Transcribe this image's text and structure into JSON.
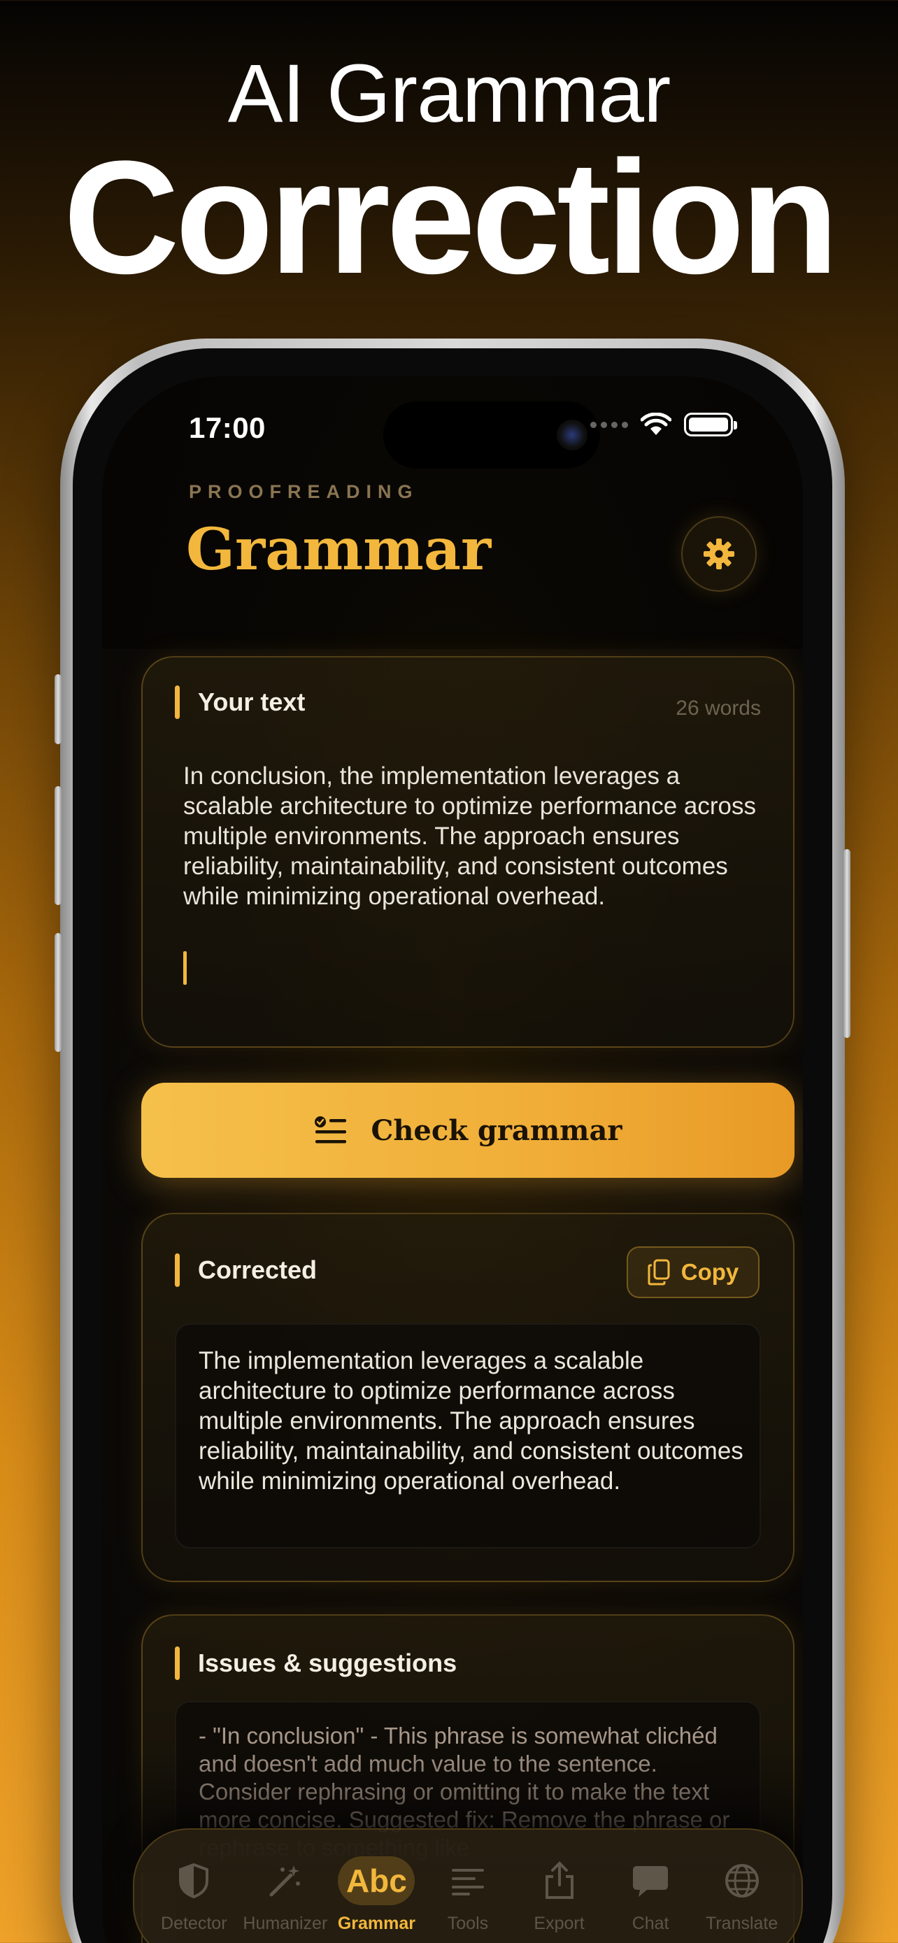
{
  "promo": {
    "line1": "AI Grammar",
    "line2": "Correction"
  },
  "status_bar": {
    "time": "17:00"
  },
  "header": {
    "eyebrow": "PROOFREADING",
    "title": "Grammar",
    "settings_icon": "gear-icon"
  },
  "input_card": {
    "label": "Your text",
    "word_count": "26 words",
    "text": "In conclusion, the implementation leverages a scalable architecture to optimize performance across multiple environments. The approach ensures reliability, maintainability, and consistent outcomes while minimizing operational overhead."
  },
  "check_button": {
    "label": "Check grammar",
    "icon": "checklist-icon"
  },
  "corrected_card": {
    "label": "Corrected",
    "copy_label": "Copy",
    "text": "The implementation leverages a scalable architecture to optimize performance across multiple environments. The approach ensures reliability, maintainability, and consistent outcomes while minimizing operational overhead."
  },
  "issues_card": {
    "label": "Issues & suggestions",
    "text": "- \"In conclusion\" - This phrase is somewhat clichéd and doesn't add much value to the sentence. Consider rephrasing or omitting it to make the text more concise. Suggested fix: Remove the phrase or rephrase to something like"
  },
  "tabbar": {
    "active": "Grammar",
    "tabs": [
      {
        "label": "Detector",
        "icon": "shield-icon"
      },
      {
        "label": "Humanizer",
        "icon": "magic-wand-icon"
      },
      {
        "label": "Grammar",
        "icon_text": "Abc"
      },
      {
        "label": "Tools",
        "icon": "lines-icon"
      },
      {
        "label": "Export",
        "icon": "share-icon"
      },
      {
        "label": "Chat",
        "icon": "chat-bubble-icon"
      },
      {
        "label": "Translate",
        "icon": "globe-icon"
      }
    ]
  },
  "colors": {
    "accent": "#f2b73c",
    "background": "#0d0b07"
  }
}
